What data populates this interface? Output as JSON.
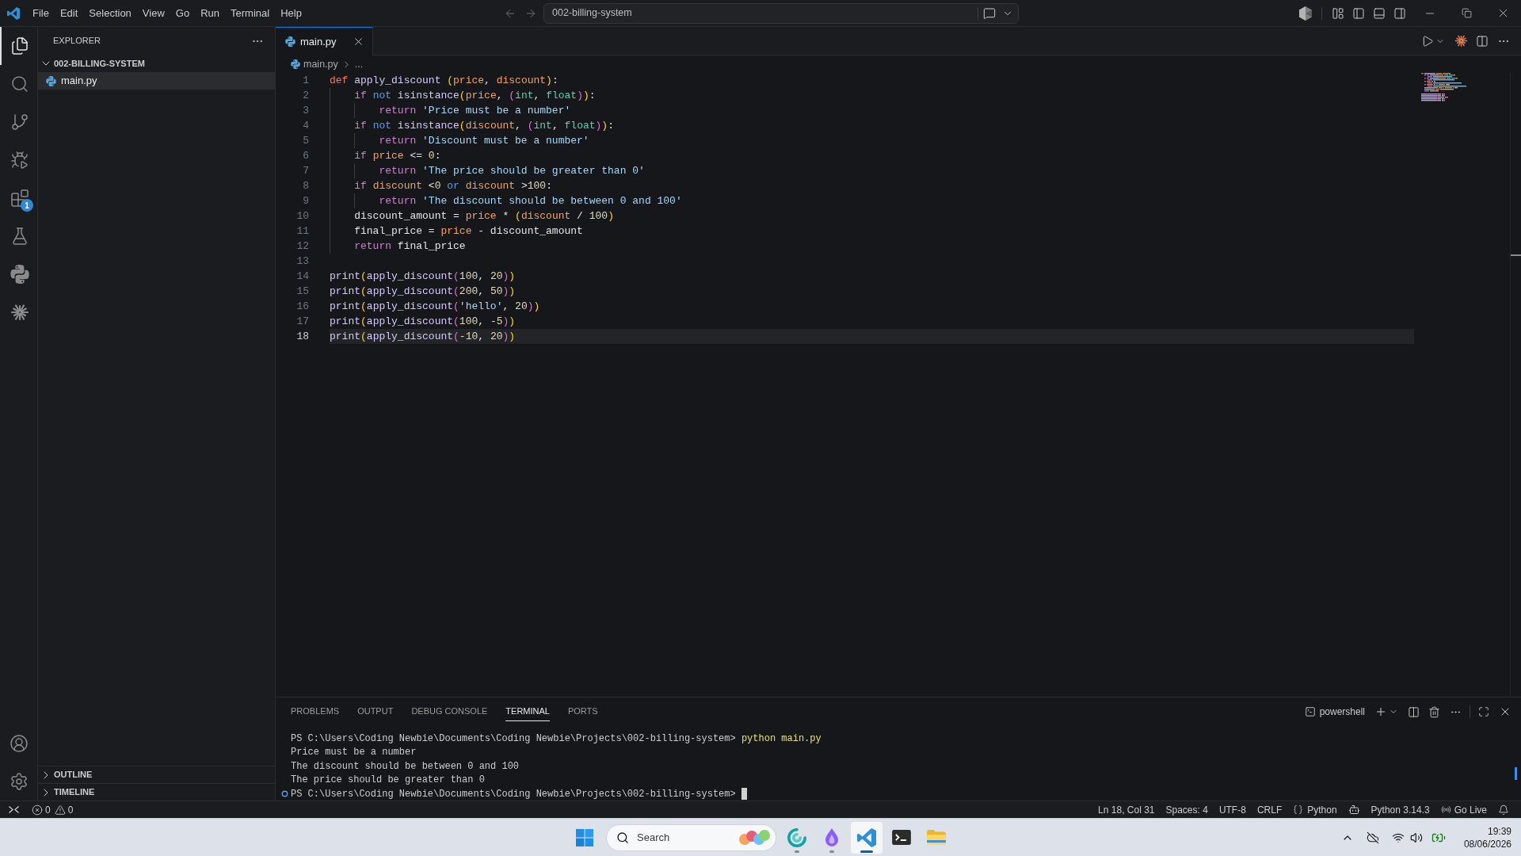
{
  "title_bar": {
    "menu": [
      "File",
      "Edit",
      "Selection",
      "View",
      "Go",
      "Run",
      "Terminal",
      "Help"
    ],
    "command_center": "002-billing-system"
  },
  "activity_bar": {
    "items": [
      {
        "kind": "explorer",
        "selected": true
      },
      {
        "kind": "search",
        "selected": false
      },
      {
        "kind": "source_control",
        "selected": false
      },
      {
        "kind": "debug",
        "selected": false
      },
      {
        "kind": "extensions",
        "selected": false,
        "badge": "1"
      },
      {
        "kind": "testing",
        "selected": false
      },
      {
        "kind": "python",
        "selected": false
      },
      {
        "kind": "sparkle",
        "selected": false
      }
    ],
    "bottom": [
      {
        "kind": "accounts"
      },
      {
        "kind": "settings"
      }
    ]
  },
  "sidebar": {
    "title": "EXPLORER",
    "folder": {
      "label": "002-BILLING-SYSTEM",
      "expanded": true,
      "children": [
        {
          "label": "main.py",
          "selected": true
        }
      ]
    },
    "sections": [
      {
        "label": "OUTLINE",
        "expanded": false
      },
      {
        "label": "TIMELINE",
        "expanded": false
      }
    ]
  },
  "editor": {
    "tabs": [
      {
        "label": "main.py",
        "selected": true
      }
    ],
    "breadcrumb": [
      "main.py",
      "..."
    ],
    "lines": [
      {
        "number": "1",
        "current": false,
        "tokens": [
          {
            "kind": "keyword",
            "text": "def "
          },
          {
            "kind": "function",
            "text": "apply_discount "
          },
          {
            "kind": "bracket",
            "text": "("
          },
          {
            "kind": "param",
            "text": "price"
          },
          {
            "kind": "text",
            "text": ", "
          },
          {
            "kind": "param",
            "text": "discount"
          },
          {
            "kind": "bracket",
            "text": ")"
          },
          {
            "kind": "text",
            "text": ":"
          }
        ]
      },
      {
        "number": "2",
        "current": false,
        "tokens": [
          {
            "kind": "control",
            "text": "    if "
          },
          {
            "kind": "logic",
            "text": "not "
          },
          {
            "kind": "function",
            "text": "isinstance"
          },
          {
            "kind": "bracket",
            "text": "("
          },
          {
            "kind": "param",
            "text": "price"
          },
          {
            "kind": "text",
            "text": ", "
          },
          {
            "kind": "bracket2",
            "text": "("
          },
          {
            "kind": "type",
            "text": "int"
          },
          {
            "kind": "text",
            "text": ", "
          },
          {
            "kind": "type",
            "text": "float"
          },
          {
            "kind": "bracket2",
            "text": ")"
          },
          {
            "kind": "bracket",
            "text": ")"
          },
          {
            "kind": "text",
            "text": ":"
          }
        ]
      },
      {
        "number": "3",
        "current": false,
        "tokens": [
          {
            "kind": "control",
            "text": "        return "
          },
          {
            "kind": "string",
            "text": "'Price must be a number'"
          }
        ]
      },
      {
        "number": "4",
        "current": false,
        "tokens": [
          {
            "kind": "control",
            "text": "    if "
          },
          {
            "kind": "logic",
            "text": "not "
          },
          {
            "kind": "function",
            "text": "isinstance"
          },
          {
            "kind": "bracket",
            "text": "("
          },
          {
            "kind": "param",
            "text": "discount"
          },
          {
            "kind": "text",
            "text": ", "
          },
          {
            "kind": "bracket2",
            "text": "("
          },
          {
            "kind": "type",
            "text": "int"
          },
          {
            "kind": "text",
            "text": ", "
          },
          {
            "kind": "type",
            "text": "float"
          },
          {
            "kind": "bracket2",
            "text": ")"
          },
          {
            "kind": "bracket",
            "text": ")"
          },
          {
            "kind": "text",
            "text": ":"
          }
        ]
      },
      {
        "number": "5",
        "current": false,
        "tokens": [
          {
            "kind": "control",
            "text": "        return "
          },
          {
            "kind": "string",
            "text": "'Discount must be a number'"
          }
        ]
      },
      {
        "number": "6",
        "current": false,
        "tokens": [
          {
            "kind": "control",
            "text": "    if "
          },
          {
            "kind": "param",
            "text": "price"
          },
          {
            "kind": "text",
            "text": " <= "
          },
          {
            "kind": "number",
            "text": "0"
          },
          {
            "kind": "text",
            "text": ":"
          }
        ]
      },
      {
        "number": "7",
        "current": false,
        "tokens": [
          {
            "kind": "control",
            "text": "        return "
          },
          {
            "kind": "string",
            "text": "'The price should be greater than 0'"
          }
        ]
      },
      {
        "number": "8",
        "current": false,
        "tokens": [
          {
            "kind": "control",
            "text": "    if "
          },
          {
            "kind": "param",
            "text": "discount"
          },
          {
            "kind": "text",
            "text": " <"
          },
          {
            "kind": "number",
            "text": "0"
          },
          {
            "kind": "logic",
            "text": " or "
          },
          {
            "kind": "param",
            "text": "discount"
          },
          {
            "kind": "text",
            "text": " >"
          },
          {
            "kind": "number",
            "text": "100"
          },
          {
            "kind": "text",
            "text": ":"
          }
        ]
      },
      {
        "number": "9",
        "current": false,
        "tokens": [
          {
            "kind": "control",
            "text": "        return "
          },
          {
            "kind": "string",
            "text": "'The discount should be between 0 and 100'"
          }
        ]
      },
      {
        "number": "10",
        "current": false,
        "tokens": [
          {
            "kind": "text",
            "text": "    discount_amount = "
          },
          {
            "kind": "param",
            "text": "price"
          },
          {
            "kind": "text",
            "text": " * "
          },
          {
            "kind": "bracket",
            "text": "("
          },
          {
            "kind": "param",
            "text": "discount"
          },
          {
            "kind": "text",
            "text": " / "
          },
          {
            "kind": "number",
            "text": "100"
          },
          {
            "kind": "bracket",
            "text": ")"
          }
        ]
      },
      {
        "number": "11",
        "current": false,
        "tokens": [
          {
            "kind": "text",
            "text": "    final_price = "
          },
          {
            "kind": "param",
            "text": "price"
          },
          {
            "kind": "text",
            "text": " - discount_amount"
          }
        ]
      },
      {
        "number": "12",
        "current": false,
        "tokens": [
          {
            "kind": "control",
            "text": "    return "
          },
          {
            "kind": "text",
            "text": "final_price"
          }
        ]
      },
      {
        "number": "13",
        "current": false
      },
      {
        "number": "14",
        "current": false,
        "tokens": [
          {
            "kind": "function",
            "text": "print"
          },
          {
            "kind": "bracket",
            "text": "("
          },
          {
            "kind": "function",
            "text": "apply_discount"
          },
          {
            "kind": "bracket2",
            "text": "("
          },
          {
            "kind": "number",
            "text": "100"
          },
          {
            "kind": "text",
            "text": ", "
          },
          {
            "kind": "number",
            "text": "20"
          },
          {
            "kind": "bracket2",
            "text": ")"
          },
          {
            "kind": "bracket",
            "text": ")"
          }
        ]
      },
      {
        "number": "15",
        "current": false,
        "tokens": [
          {
            "kind": "function",
            "text": "print"
          },
          {
            "kind": "bracket",
            "text": "("
          },
          {
            "kind": "function",
            "text": "apply_discount"
          },
          {
            "kind": "bracket2",
            "text": "("
          },
          {
            "kind": "number",
            "text": "200"
          },
          {
            "kind": "text",
            "text": ", "
          },
          {
            "kind": "number",
            "text": "50"
          },
          {
            "kind": "bracket2",
            "text": ")"
          },
          {
            "kind": "bracket",
            "text": ")"
          }
        ]
      },
      {
        "number": "16",
        "current": false,
        "tokens": [
          {
            "kind": "function",
            "text": "print"
          },
          {
            "kind": "bracket",
            "text": "("
          },
          {
            "kind": "function",
            "text": "apply_discount"
          },
          {
            "kind": "bracket2",
            "text": "("
          },
          {
            "kind": "string",
            "text": "'hello'"
          },
          {
            "kind": "text",
            "text": ", "
          },
          {
            "kind": "number",
            "text": "20"
          },
          {
            "kind": "bracket2",
            "text": ")"
          },
          {
            "kind": "bracket",
            "text": ")"
          }
        ]
      },
      {
        "number": "17",
        "current": false,
        "tokens": [
          {
            "kind": "function",
            "text": "print"
          },
          {
            "kind": "bracket",
            "text": "("
          },
          {
            "kind": "function",
            "text": "apply_discount"
          },
          {
            "kind": "bracket2",
            "text": "("
          },
          {
            "kind": "number",
            "text": "100"
          },
          {
            "kind": "text",
            "text": ", "
          },
          {
            "kind": "number",
            "text": "-5"
          },
          {
            "kind": "bracket2",
            "text": ")"
          },
          {
            "kind": "bracket",
            "text": ")"
          }
        ]
      },
      {
        "number": "18",
        "current": true,
        "tokens": [
          {
            "kind": "function",
            "text": "print"
          },
          {
            "kind": "bracket",
            "text": "("
          },
          {
            "kind": "function",
            "text": "apply_discount"
          },
          {
            "kind": "bracket2",
            "text": "("
          },
          {
            "kind": "number",
            "text": "-10"
          },
          {
            "kind": "text",
            "text": ", "
          },
          {
            "kind": "number",
            "text": "20"
          },
          {
            "kind": "bracket2",
            "text": ")"
          },
          {
            "kind": "bracket",
            "text": ")"
          }
        ]
      }
    ]
  },
  "panel": {
    "tabs": [
      {
        "label": "PROBLEMS",
        "selected": false
      },
      {
        "label": "OUTPUT",
        "selected": false
      },
      {
        "label": "DEBUG CONSOLE",
        "selected": false
      },
      {
        "label": "TERMINAL",
        "selected": true
      },
      {
        "label": "PORTS",
        "selected": false
      }
    ],
    "shell": "powershell",
    "terminal": [
      {
        "kind": "command",
        "prompt": "PS C:\\Users\\Coding Newbie\\Documents\\Coding Newbie\\Projects\\002-billing-system>",
        "command": "python main.py"
      },
      {
        "kind": "output",
        "text": "Price must be a number"
      },
      {
        "kind": "output",
        "text": "The discount should be between 0 and 100"
      },
      {
        "kind": "output",
        "text": "The price should be greater than 0"
      },
      {
        "kind": "prompt",
        "prompt": "PS C:\\Users\\Coding Newbie\\Documents\\Coding Newbie\\Projects\\002-billing-system>"
      }
    ]
  },
  "status_bar": {
    "errors": "0",
    "warnings": "0",
    "items": [
      {
        "kind": "text",
        "text": "Ln 18, Col 31"
      },
      {
        "kind": "text",
        "text": "Spaces: 4"
      },
      {
        "kind": "text",
        "text": "UTF-8"
      },
      {
        "kind": "text",
        "text": "CRLF"
      },
      {
        "kind": "language",
        "text": "Python"
      },
      {
        "kind": "copilot"
      },
      {
        "kind": "text",
        "text": "Python 3.14.3"
      },
      {
        "kind": "live",
        "text": "Go Live"
      },
      {
        "kind": "notifications"
      }
    ]
  },
  "taskbar": {
    "search": {
      "placeholder": "Search"
    },
    "apps": [
      {
        "kind": "swirl",
        "running": true,
        "selected": false
      },
      {
        "kind": "drop",
        "running": true,
        "selected": false
      },
      {
        "kind": "code",
        "running": true,
        "selected": true
      },
      {
        "kind": "terminal",
        "running": false,
        "selected": false
      },
      {
        "kind": "files",
        "running": false,
        "selected": false
      }
    ],
    "clock": {
      "time": "19:39",
      "date": "08/06/2026"
    }
  }
}
